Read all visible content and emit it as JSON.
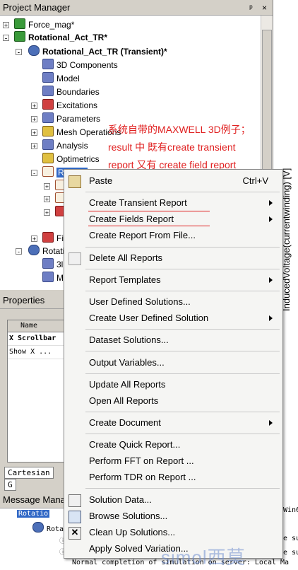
{
  "project_manager": {
    "title": "Project Manager",
    "title_buttons": [
      "ᵖ",
      "×"
    ],
    "tree": [
      {
        "label": "Force_mag*"
      },
      {
        "label": "Rotational_Act_TR*"
      },
      {
        "label": "Rotational_Act_TR (Transient)*"
      },
      {
        "label": "3D Components"
      },
      {
        "label": "Model"
      },
      {
        "label": "Boundaries"
      },
      {
        "label": "Excitations"
      },
      {
        "label": "Parameters"
      },
      {
        "label": "Mesh Operations"
      },
      {
        "label": "Analysis"
      },
      {
        "label": "Optimetrics"
      },
      {
        "label": "Results"
      },
      {
        "label": "Fi"
      },
      {
        "label": "Rotati"
      },
      {
        "label": "3l"
      },
      {
        "label": "M"
      }
    ]
  },
  "annotation": {
    "line1": "系统自带的MAXWELL 3D例子；",
    "line2": "result 中 既有create transient",
    "line3": "report 又有 create field report"
  },
  "plot": {
    "ylabel": "InducedVoltage(currentwinding) [V]"
  },
  "properties": {
    "title": "Properties",
    "col_header": "Name",
    "rows": [
      "X Scrollbar",
      "Show X ..."
    ],
    "tabs": [
      "Cartesian",
      "G"
    ]
  },
  "messages": {
    "title": "Message Manag",
    "selected_item": "Rotatio",
    "sub_item": "Rota",
    "line_suffix_1": "Win6",
    "line_suffix_2": "e su",
    "line_suffix_3": "e su",
    "last_line": "Normal completion of simulation on server: Local Ma"
  },
  "context_menu": {
    "items": [
      {
        "label": "Paste",
        "shortcut": "Ctrl+V",
        "submenu": false
      },
      {
        "label": "Create Transient Report",
        "submenu": true
      },
      {
        "label": "Create Fields Report",
        "submenu": true
      },
      {
        "label": "Create Report From File...",
        "submenu": false
      },
      {
        "label": "Delete All Reports",
        "submenu": false
      },
      {
        "label": "Report Templates",
        "submenu": true
      },
      {
        "label": "User Defined Solutions...",
        "submenu": false
      },
      {
        "label": "Create User Defined Solution",
        "submenu": true
      },
      {
        "label": "Dataset Solutions...",
        "submenu": false
      },
      {
        "label": "Output Variables...",
        "submenu": false
      },
      {
        "label": "Update All Reports",
        "submenu": false
      },
      {
        "label": "Open All Reports",
        "submenu": false
      },
      {
        "label": "Create Document",
        "submenu": true
      },
      {
        "label": "Create Quick Report...",
        "submenu": false
      },
      {
        "label": "Perform FFT on Report ...",
        "submenu": false
      },
      {
        "label": "Perform TDR on Report ...",
        "submenu": false
      },
      {
        "label": "Solution Data...",
        "submenu": false
      },
      {
        "label": "Browse Solutions...",
        "submenu": false
      },
      {
        "label": "Clean Up Solutions...",
        "submenu": false
      },
      {
        "label": "Apply Solved Variation...",
        "submenu": false
      }
    ]
  },
  "watermark": "simol西莫",
  "colors": {
    "annotation_red": "#e02020",
    "menu_bg": "#f5f5f3",
    "selection_blue": "#3168c6"
  }
}
